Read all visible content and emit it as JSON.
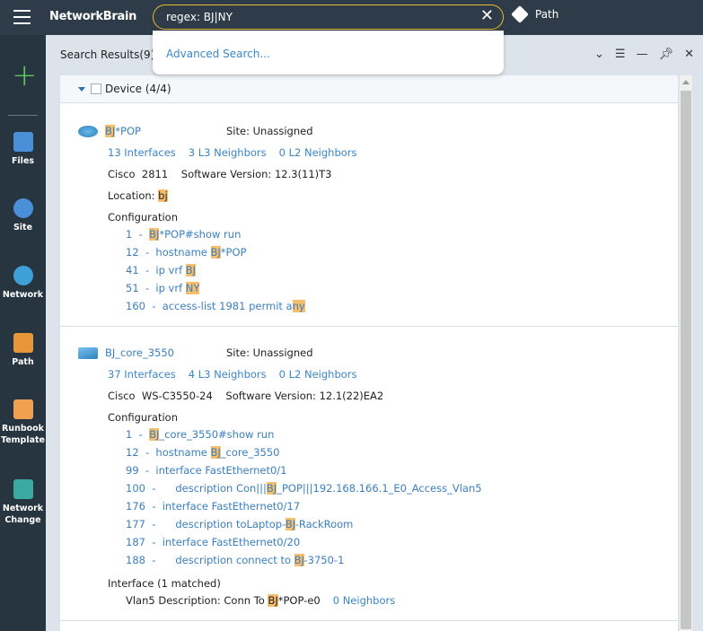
{
  "app": {
    "logo": "NetworkBrain",
    "path_label": "Path"
  },
  "search": {
    "value": "regex: BJ|NY",
    "dropdown_item": "Advanced Search..."
  },
  "sidebar": {
    "items": [
      {
        "label": "Files",
        "icon": "folder-icon",
        "color": "#4a90d9"
      },
      {
        "label": "Site",
        "icon": "site-icon",
        "color": "#4a90d9"
      },
      {
        "label": "Network",
        "icon": "network-icon",
        "color": "#3ea0d6"
      },
      {
        "label": "Path",
        "icon": "path-icon",
        "color": "#e8963a"
      },
      {
        "label": "Runbook Template",
        "icon": "runbook-icon",
        "color": "#f0a050"
      },
      {
        "label": "Network Change",
        "icon": "network-change-icon",
        "color": "#3aa9a0"
      }
    ]
  },
  "panel": {
    "title": "Search Results(9)",
    "group": "Device (4/4)"
  },
  "colors": {
    "highlight": "#f5bf6e",
    "link": "#3a86c8",
    "topbar": "#2d3c48",
    "accent": "#e8b830"
  },
  "devices": [
    {
      "icon": "router-icon",
      "name": [
        {
          "t": "BJ",
          "hl": true
        },
        {
          "t": "*POP"
        }
      ],
      "site": "Site: Unassigned",
      "links": [
        "13 Interfaces",
        "3 L3 Neighbors",
        "0 L2 Neighbors"
      ],
      "info": "Cisco  2811    Software Version: 12.3(11)T3",
      "location": [
        {
          "t": "Location: "
        },
        {
          "t": "bj",
          "hl": true
        }
      ],
      "config_label": "Configuration",
      "config": [
        [
          {
            "t": "1  -  "
          },
          {
            "t": "BJ",
            "hl": true
          },
          {
            "t": "*POP#show run"
          }
        ],
        [
          {
            "t": "12  -  hostname "
          },
          {
            "t": "BJ",
            "hl": true
          },
          {
            "t": "*POP"
          }
        ],
        [
          {
            "t": "41  -  ip vrf "
          },
          {
            "t": "BJ",
            "hl": true
          }
        ],
        [
          {
            "t": "51  -  ip vrf "
          },
          {
            "t": "NY",
            "hl": true
          }
        ],
        [
          {
            "t": "160  -  access-list 1981 permit a"
          },
          {
            "t": "ny",
            "hl": true
          }
        ]
      ]
    },
    {
      "icon": "switch-icon",
      "name": [
        {
          "t": "BJ_core_3550"
        }
      ],
      "site": "Site: Unassigned",
      "links": [
        "37 Interfaces",
        "4 L3 Neighbors",
        "0 L2 Neighbors"
      ],
      "info": "Cisco  WS-C3550-24    Software Version: 12.1(22)EA2",
      "config_label": "Configuration",
      "config": [
        [
          {
            "t": "1  -  "
          },
          {
            "t": "BJ",
            "hl": true
          },
          {
            "t": "_core_3550#show run"
          }
        ],
        [
          {
            "t": "12  -  hostname "
          },
          {
            "t": "BJ",
            "hl": true
          },
          {
            "t": "_core_3550"
          }
        ],
        [
          {
            "t": "99  -  interface FastEthernet0/1"
          }
        ],
        [
          {
            "t": "100  -      description Con|||"
          },
          {
            "t": "BJ",
            "hl": true
          },
          {
            "t": "_POP|||192.168.166.1_E0_Access_Vlan5"
          }
        ],
        [
          {
            "t": "176  -  interface FastEthernet0/17"
          }
        ],
        [
          {
            "t": "177  -      description toLaptop-"
          },
          {
            "t": "BJ",
            "hl": true
          },
          {
            "t": "-RackRoom"
          }
        ],
        [
          {
            "t": "187  -  interface FastEthernet0/20"
          }
        ],
        [
          {
            "t": "188  -      description connect to "
          },
          {
            "t": "BJ",
            "hl": true
          },
          {
            "t": "-3750-1"
          }
        ]
      ],
      "interface_label": "Interface (1 matched)",
      "interface_line": [
        {
          "t": "Vlan5 Description: Conn To "
        },
        {
          "t": "BJ",
          "hl": true
        },
        {
          "t": "*POP-e0"
        }
      ],
      "interface_link": "0 Neighbors"
    }
  ]
}
